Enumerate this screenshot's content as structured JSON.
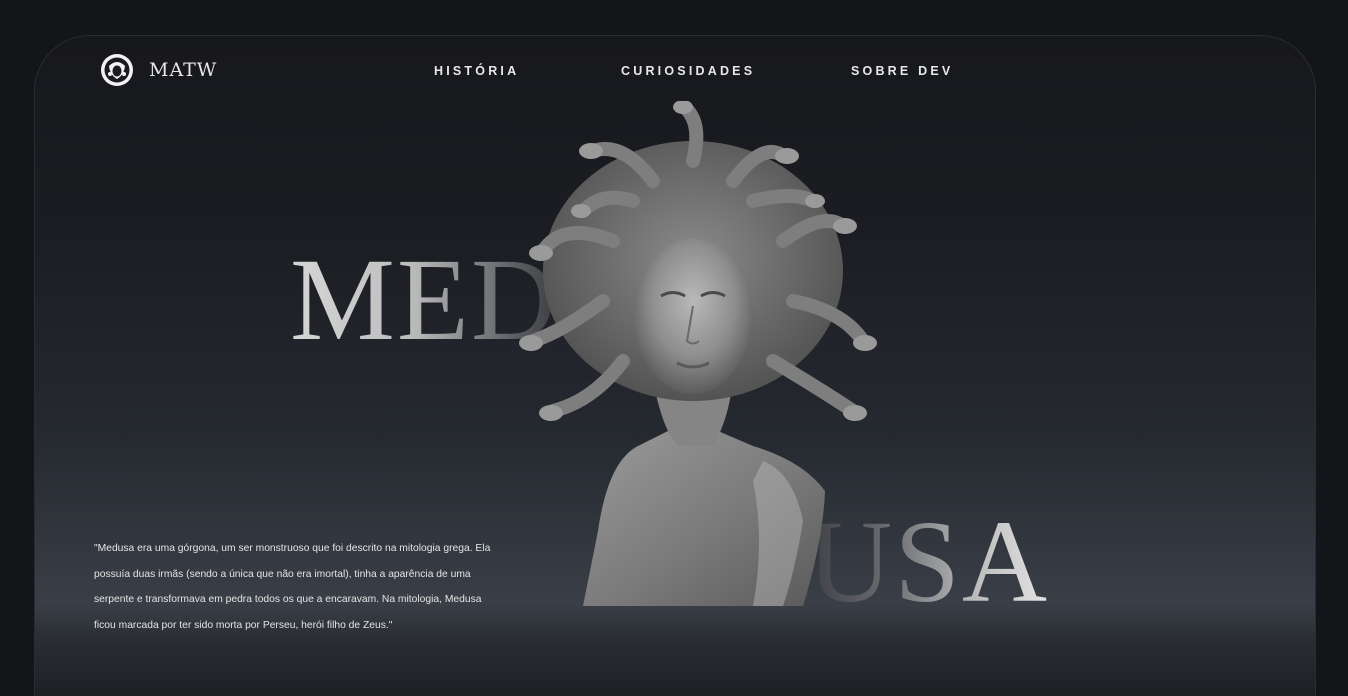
{
  "brand": {
    "name": "MATW",
    "icon": "medusa-head-logo-icon"
  },
  "nav": {
    "items": [
      {
        "label": "HISTÓRIA"
      },
      {
        "label": "CURIOSIDADES"
      },
      {
        "label": "SOBRE DEV"
      }
    ]
  },
  "hero": {
    "title_part1": "MED",
    "title_part2": "USA",
    "image": "medusa-statue-image",
    "quote": "\"Medusa era uma górgona, um ser monstruoso que foi descrito na mitologia grega. Ela possuía duas irmãs (sendo a única que não era imortal), tinha a aparência de uma serpente e transformava em pedra todos os que a encaravam. Na mitologia, Medusa ficou marcada por ter sido morta por Perseu, herói filho de Zeus.\""
  },
  "colors": {
    "background": "#141519",
    "text": "#e8e8e8",
    "statue": "#8a8a8a"
  }
}
